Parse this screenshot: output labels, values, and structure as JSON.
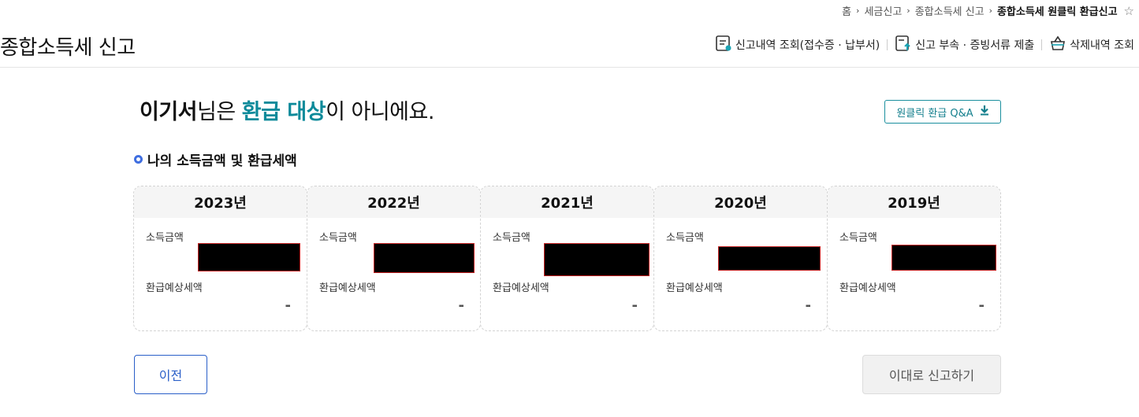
{
  "breadcrumb": {
    "home": "홈",
    "items": [
      "세금신고",
      "종합소득세 신고"
    ],
    "current": "종합소득세 원클릭 환급신고",
    "favorite_icon": "star-outline-icon"
  },
  "header": {
    "title": "종합소득세 신고",
    "links": [
      {
        "label": "신고내역 조회(접수증 · 납부서)",
        "icon": "document-list-icon"
      },
      {
        "label": "신고 부속 · 증빙서류 제출",
        "icon": "document-upload-icon"
      },
      {
        "label": "삭제내역 조회",
        "icon": "basket-icon"
      }
    ]
  },
  "result": {
    "name": "이기서",
    "suffix": "님은 ",
    "emphasis": "환급 대상",
    "tail": "이 아니에요."
  },
  "qa_button": {
    "label": "원클릭 환급 Q&A",
    "icon": "download-icon"
  },
  "section": {
    "title": "나의 소득금액 및 환급세액"
  },
  "years": [
    {
      "year": "2023년",
      "income_label": "소득금액",
      "income_value": "[redacted]",
      "refund_label": "환급예상세액",
      "refund_value": "-"
    },
    {
      "year": "2022년",
      "income_label": "소득금액",
      "income_value": "[redacted]",
      "refund_label": "환급예상세액",
      "refund_value": "-"
    },
    {
      "year": "2021년",
      "income_label": "소득금액",
      "income_value": "[redacted]",
      "refund_label": "환급예상세액",
      "refund_value": "-"
    },
    {
      "year": "2020년",
      "income_label": "소득금액",
      "income_value": "[redacted]",
      "refund_label": "환급예상세액",
      "refund_value": "-"
    },
    {
      "year": "2019년",
      "income_label": "소득금액",
      "income_value": "[redacted]",
      "refund_label": "환급예상세액",
      "refund_value": "-"
    }
  ],
  "buttons": {
    "prev": "이전",
    "submit": "이대로 신고하기"
  },
  "colors": {
    "accent": "#0c8a9a",
    "primary": "#2a5fc8",
    "bullet": "#3f6ee0"
  }
}
